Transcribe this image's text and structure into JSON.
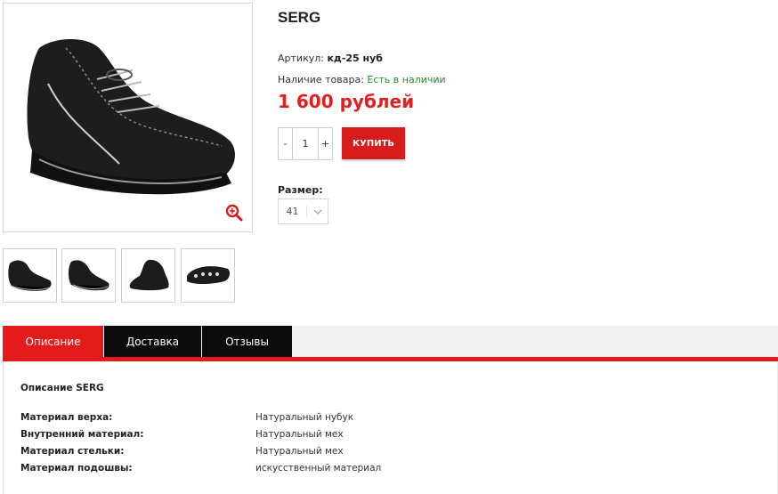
{
  "product": {
    "title": "SERG",
    "sku_label": "Артикул:",
    "sku_value": "кд-25 нуб",
    "availability_label": "Наличие товара:",
    "availability_value": "Есть в наличии",
    "price": "1 600 рублей",
    "quantity": "1",
    "minus": "-",
    "plus": "+",
    "buy_label": "КУПИТЬ",
    "size_label": "Размер:",
    "size_value": "41"
  },
  "gallery": {
    "main_icon": "zoom-icon",
    "thumbnails": [
      "shoe-side",
      "shoe-angle",
      "shoe-front",
      "shoe-sole"
    ]
  },
  "tabs": [
    {
      "label": "Описание",
      "active": true
    },
    {
      "label": "Доставка",
      "active": false
    },
    {
      "label": "Отзывы",
      "active": false
    }
  ],
  "description": {
    "title": "Описание SERG",
    "specs": [
      {
        "key": "Материал верха:",
        "value": "Натуральный нубук"
      },
      {
        "key": "Внутренний материал:",
        "value": "Натуральный мех"
      },
      {
        "key": "Материал стельки:",
        "value": "Натуральный мех"
      },
      {
        "key": "Материал подошвы:",
        "value": "искусственный материал"
      }
    ]
  },
  "colors": {
    "accent": "#e41b1b",
    "price": "#e31e1e",
    "in_stock": "#2e8b2e",
    "tab_dark": "#0b0b0b"
  }
}
